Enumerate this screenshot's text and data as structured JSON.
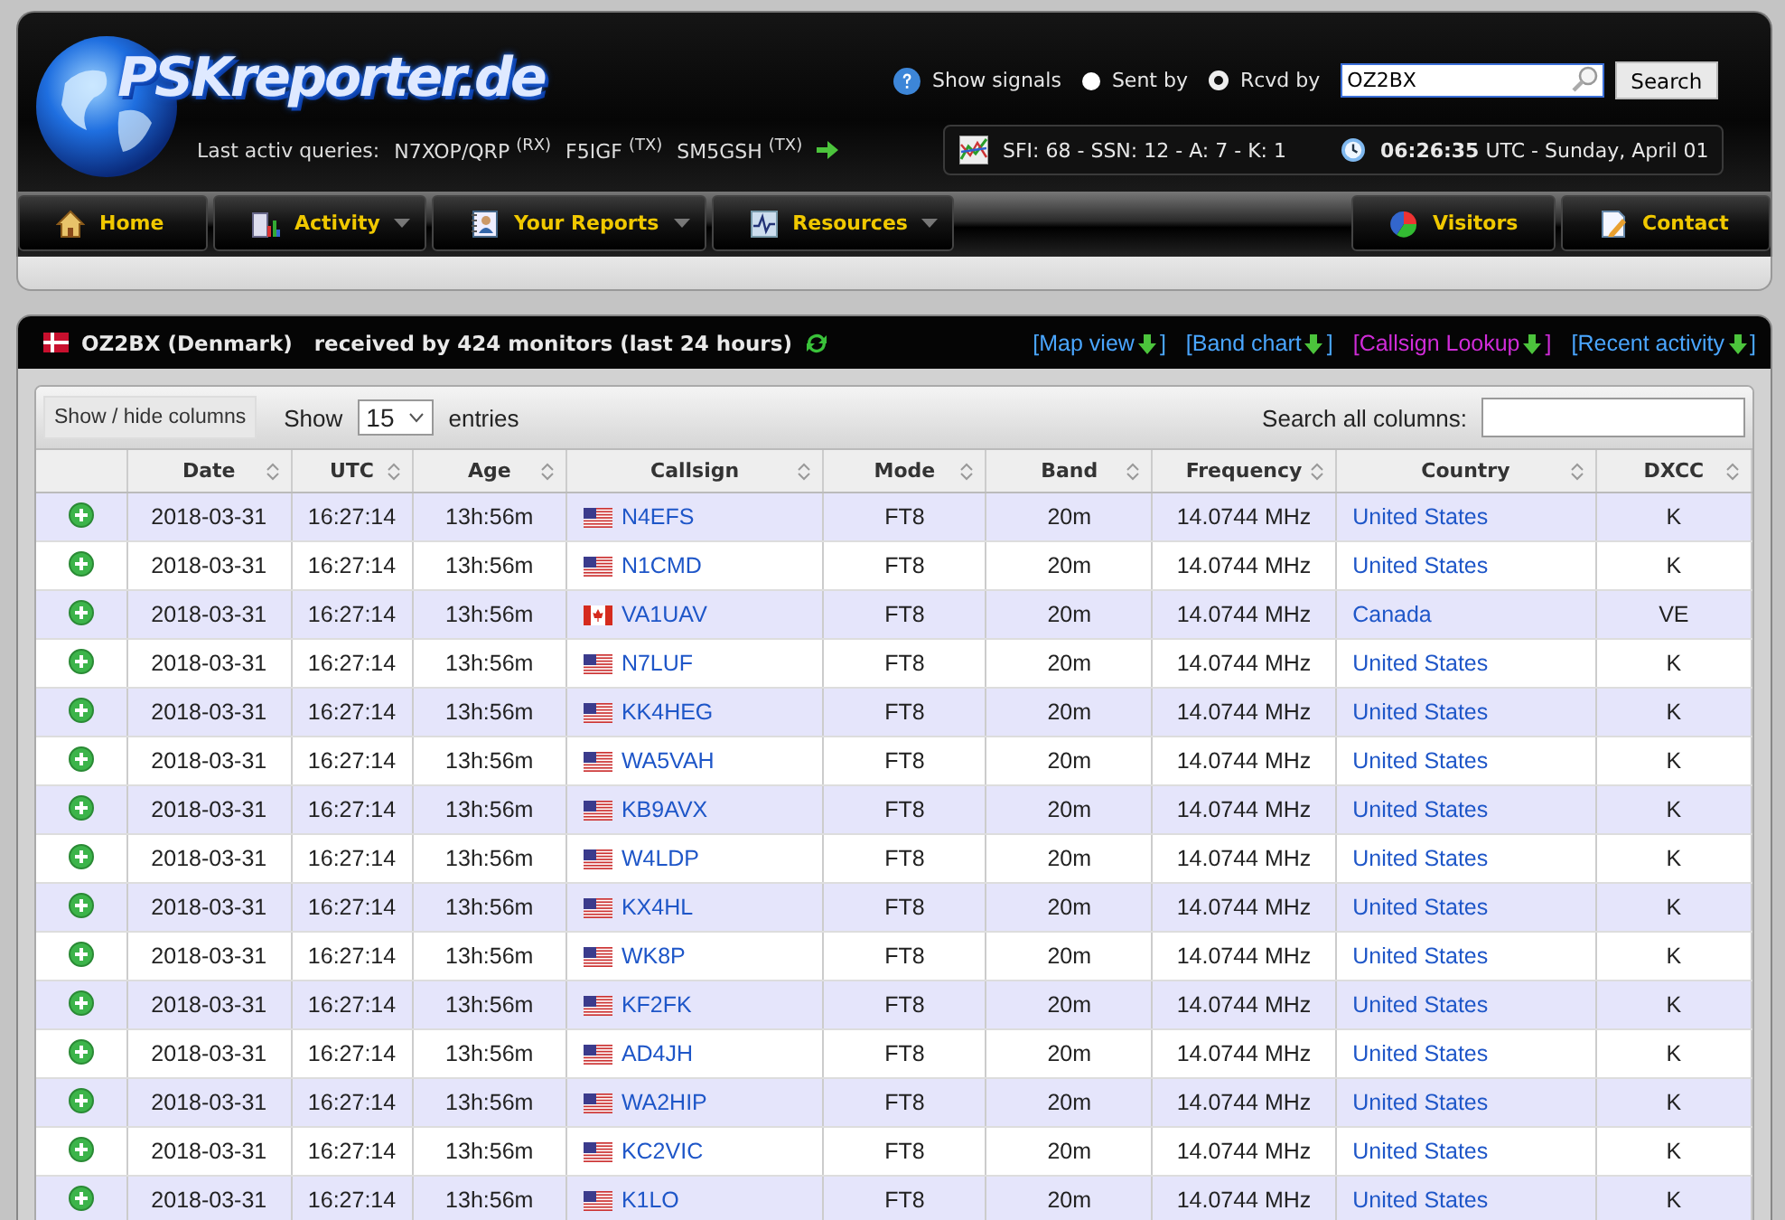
{
  "header": {
    "logo": "PSKreporter.de",
    "last_queries": {
      "label": "Last activ queries:",
      "items": [
        "N7XOP/QRP $^{(RX)}$",
        "F5IGF $^{(TX)}$",
        "SM5GSH $^{(TX)}$"
      ]
    },
    "show_signals": {
      "label": "Show signals",
      "options": [
        {
          "label": "Sent by",
          "selected": false
        },
        {
          "label": "Rcvd by",
          "selected": true
        }
      ]
    },
    "search": {
      "value": "OZ2BX",
      "button": "Search"
    },
    "solar": "SFI: 68 - SSN: 12 - A: 7 - K: 1",
    "clock": "**06:26:35** UTC - Sunday, April 01"
  },
  "nav_left": [
    {
      "label": "Home",
      "dropdown": false
    },
    {
      "label": "Activity",
      "dropdown": true
    },
    {
      "label": "Your Reports",
      "dropdown": true
    },
    {
      "label": "Resources",
      "dropdown": true
    }
  ],
  "nav_right": [
    {
      "label": "Visitors",
      "dropdown": false
    },
    {
      "label": "Contact",
      "dropdown": false
    }
  ],
  "panel": {
    "flag": {
      "kind": "denmark"
    },
    "title": "OZ2BX (Denmark)   received by 424 monitors (last 24 hours)",
    "links": [
      {
        "open": "[Map view",
        "close": "]",
        "visited": false
      },
      {
        "open": "[Band chart",
        "close": "]",
        "visited": false
      },
      {
        "open": "[Callsign Lookup",
        "close": "]",
        "visited": true
      },
      {
        "open": "[Recent activity",
        "close": "]",
        "visited": false
      }
    ]
  },
  "table": {
    "columns_button": "Show / hide columns",
    "show_label": "Show",
    "page_size": "15",
    "entries_label": "entries",
    "search_label": "Search all columns:",
    "columns": [
      "Date",
      "UTC",
      "Age",
      "Callsign",
      "Mode",
      "Band",
      "Frequency",
      "Country",
      "DXCC"
    ],
    "rows": [
      {
        "date": "2018-03-31",
        "utc": "16:27:14",
        "age": "13h:56m",
        "flag": {
          "kind": "usa"
        },
        "callsign": "N4EFS",
        "mode": "FT8",
        "band": "20m",
        "frequency": "14.0744 MHz",
        "country": "United States",
        "dxcc": "K"
      },
      {
        "date": "2018-03-31",
        "utc": "16:27:14",
        "age": "13h:56m",
        "flag": {
          "kind": "usa"
        },
        "callsign": "N1CMD",
        "mode": "FT8",
        "band": "20m",
        "frequency": "14.0744 MHz",
        "country": "United States",
        "dxcc": "K"
      },
      {
        "date": "2018-03-31",
        "utc": "16:27:14",
        "age": "13h:56m",
        "flag": {
          "kind": "canada"
        },
        "callsign": "VA1UAV",
        "mode": "FT8",
        "band": "20m",
        "frequency": "14.0744 MHz",
        "country": "Canada",
        "dxcc": "VE"
      },
      {
        "date": "2018-03-31",
        "utc": "16:27:14",
        "age": "13h:56m",
        "flag": {
          "kind": "usa"
        },
        "callsign": "N7LUF",
        "mode": "FT8",
        "band": "20m",
        "frequency": "14.0744 MHz",
        "country": "United States",
        "dxcc": "K"
      },
      {
        "date": "2018-03-31",
        "utc": "16:27:14",
        "age": "13h:56m",
        "flag": {
          "kind": "usa"
        },
        "callsign": "KK4HEG",
        "mode": "FT8",
        "band": "20m",
        "frequency": "14.0744 MHz",
        "country": "United States",
        "dxcc": "K"
      },
      {
        "date": "2018-03-31",
        "utc": "16:27:14",
        "age": "13h:56m",
        "flag": {
          "kind": "usa"
        },
        "callsign": "WA5VAH",
        "mode": "FT8",
        "band": "20m",
        "frequency": "14.0744 MHz",
        "country": "United States",
        "dxcc": "K"
      },
      {
        "date": "2018-03-31",
        "utc": "16:27:14",
        "age": "13h:56m",
        "flag": {
          "kind": "usa"
        },
        "callsign": "KB9AVX",
        "mode": "FT8",
        "band": "20m",
        "frequency": "14.0744 MHz",
        "country": "United States",
        "dxcc": "K"
      },
      {
        "date": "2018-03-31",
        "utc": "16:27:14",
        "age": "13h:56m",
        "flag": {
          "kind": "usa"
        },
        "callsign": "W4LDP",
        "mode": "FT8",
        "band": "20m",
        "frequency": "14.0744 MHz",
        "country": "United States",
        "dxcc": "K"
      },
      {
        "date": "2018-03-31",
        "utc": "16:27:14",
        "age": "13h:56m",
        "flag": {
          "kind": "usa"
        },
        "callsign": "KX4HL",
        "mode": "FT8",
        "band": "20m",
        "frequency": "14.0744 MHz",
        "country": "United States",
        "dxcc": "K"
      },
      {
        "date": "2018-03-31",
        "utc": "16:27:14",
        "age": "13h:56m",
        "flag": {
          "kind": "usa"
        },
        "callsign": "WK8P",
        "mode": "FT8",
        "band": "20m",
        "frequency": "14.0744 MHz",
        "country": "United States",
        "dxcc": "K"
      },
      {
        "date": "2018-03-31",
        "utc": "16:27:14",
        "age": "13h:56m",
        "flag": {
          "kind": "usa"
        },
        "callsign": "KF2FK",
        "mode": "FT8",
        "band": "20m",
        "frequency": "14.0744 MHz",
        "country": "United States",
        "dxcc": "K"
      },
      {
        "date": "2018-03-31",
        "utc": "16:27:14",
        "age": "13h:56m",
        "flag": {
          "kind": "usa"
        },
        "callsign": "AD4JH",
        "mode": "FT8",
        "band": "20m",
        "frequency": "14.0744 MHz",
        "country": "United States",
        "dxcc": "K"
      },
      {
        "date": "2018-03-31",
        "utc": "16:27:14",
        "age": "13h:56m",
        "flag": {
          "kind": "usa"
        },
        "callsign": "WA2HIP",
        "mode": "FT8",
        "band": "20m",
        "frequency": "14.0744 MHz",
        "country": "United States",
        "dxcc": "K"
      },
      {
        "date": "2018-03-31",
        "utc": "16:27:14",
        "age": "13h:56m",
        "flag": {
          "kind": "usa"
        },
        "callsign": "KC2VIC",
        "mode": "FT8",
        "band": "20m",
        "frequency": "14.0744 MHz",
        "country": "United States",
        "dxcc": "K"
      },
      {
        "date": "2018-03-31",
        "utc": "16:27:14",
        "age": "13h:56m",
        "flag": {
          "kind": "usa"
        },
        "callsign": "K1LO",
        "mode": "FT8",
        "band": "20m",
        "frequency": "14.0744 MHz",
        "country": "United States",
        "dxcc": "K"
      }
    ]
  }
}
